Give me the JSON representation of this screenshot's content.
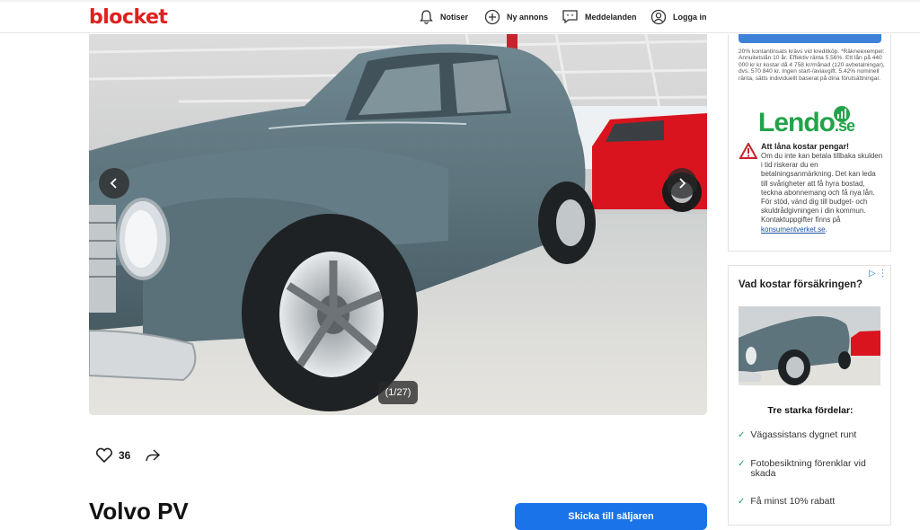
{
  "header": {
    "logo": "blocket",
    "nav": [
      {
        "label": "Notiser",
        "icon": "bell-icon"
      },
      {
        "label": "Ny annons",
        "icon": "plus-circle-icon"
      },
      {
        "label": "Meddelanden",
        "icon": "chat-icon"
      },
      {
        "label": "Logga in",
        "icon": "user-icon"
      }
    ]
  },
  "gallery": {
    "counter": "(1/27)",
    "prev": "chevron-left-icon",
    "next": "chevron-right-icon"
  },
  "actions": {
    "likes": "36"
  },
  "listing": {
    "title": "Volvo PV",
    "cta_label": "Skicka till säljaren"
  },
  "ad_loan": {
    "fine_print": "20% kontantinsats krävs vid kreditköp. *Räkneexempel: Annuitetslån 10 år. Effektiv ränta 5.56%. Ett lån på 440 000 kr kr kostar då 4 758 kr/månad (120 avbetalningar), dvs. 570 840 kr. Ingen start-/aviavgift. 5.42% nominell ränta, sätts individuellt baserat på dina förutsättningar.",
    "brand": "Lendo",
    "brand_suffix": ".se",
    "warning_title": "Att låna kostar pengar!",
    "warning_body": "Om du inte kan betala tillbaka skulden i tid riskerar du en betalningsanmärkning. Det kan leda till svårigheter att få hyra bostad, teckna abonnemang och få nya lån. För stöd, vänd dig till budget- och skuldrådgivningen i din kommun. Kontaktuppgifter finns på",
    "warning_link": "konsumentverket.se",
    "warning_end": "."
  },
  "ad_insurance": {
    "question": "Vad kostar försäkringen?",
    "heading": "Tre starka fördelar:",
    "features": [
      "Vägassistans dygnet runt",
      "Fotobesiktning förenklar vid skada",
      "Få minst 10% rabatt"
    ]
  },
  "colors": {
    "brand_red": "#e02020",
    "lendo_green": "#23a34a",
    "cta_blue": "#1a73e8"
  }
}
